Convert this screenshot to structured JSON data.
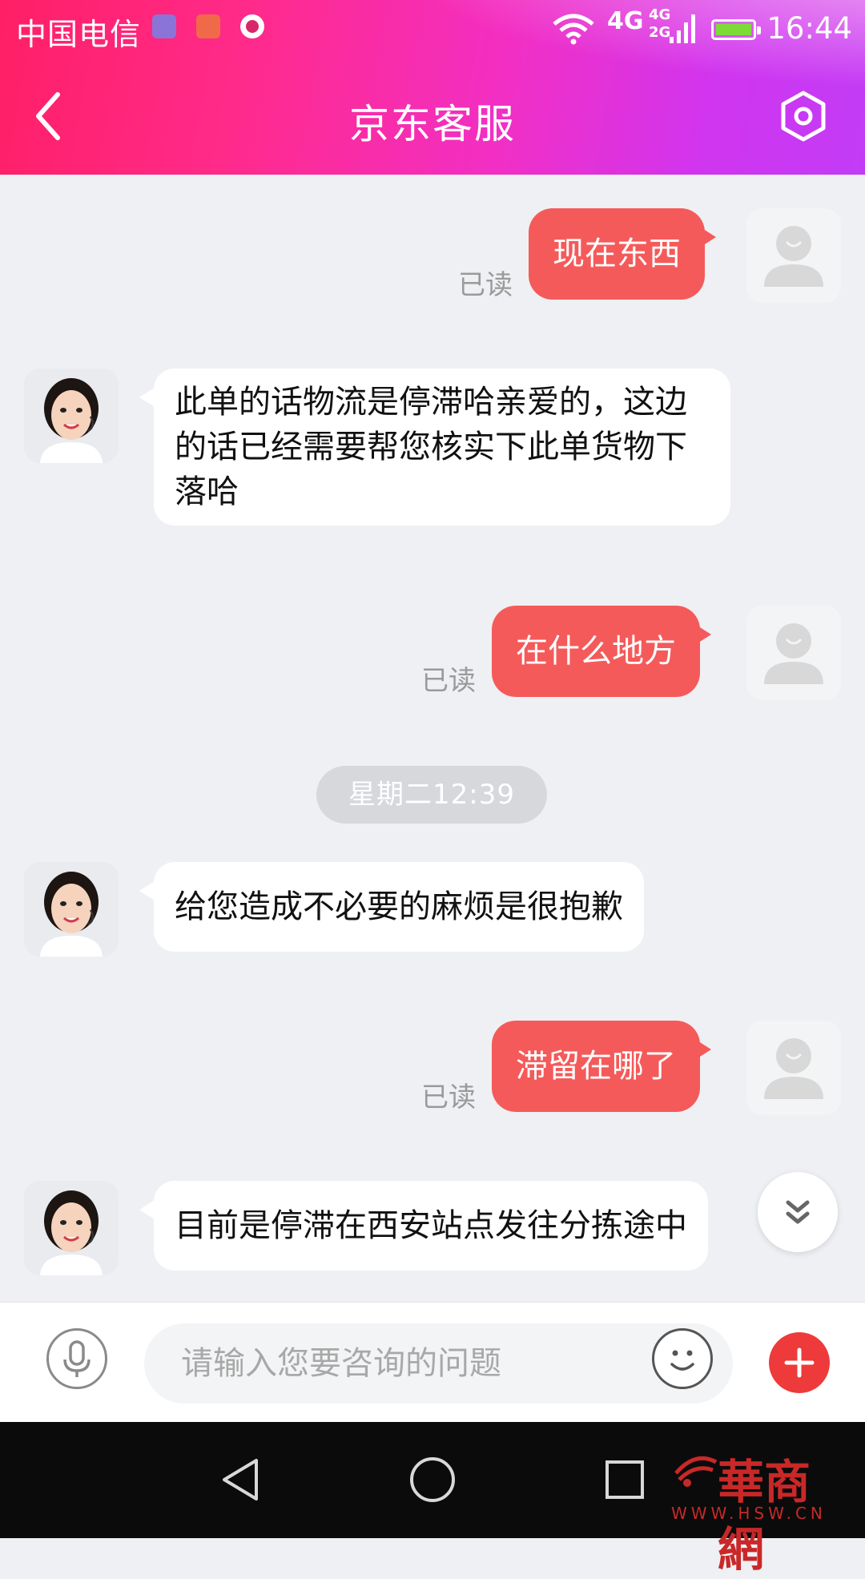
{
  "status_bar": {
    "carrier": "中国电信",
    "network": "4G",
    "network2_top": "4G",
    "network2_bottom": "2G",
    "time": "16:44"
  },
  "header": {
    "title": "京东客服"
  },
  "messages": [
    {
      "side": "user",
      "text": "现在东西",
      "status": "已读"
    },
    {
      "side": "agent",
      "lines": [
        "此单的话物流是停滞哈亲爱的，这边",
        "的话已经需要帮您核实下此单货物下",
        "落哈"
      ]
    },
    {
      "side": "user",
      "text": "在什么地方",
      "status": "已读"
    },
    {
      "timestamp": "星期二12:39"
    },
    {
      "side": "agent",
      "text": "给您造成不必要的麻烦是很抱歉"
    },
    {
      "side": "user",
      "text": "滞留在哪了",
      "status": "已读"
    },
    {
      "side": "agent",
      "text": "目前是停滞在西安站点发往分拣途中"
    }
  ],
  "input": {
    "placeholder": "请输入您要咨询的问题"
  },
  "watermark": {
    "text": "華商網",
    "url": "WWW.HSW.CN"
  },
  "colors": {
    "accent": "#f55a5a",
    "header_start": "#ff1f66",
    "header_end": "#c23cf6"
  }
}
